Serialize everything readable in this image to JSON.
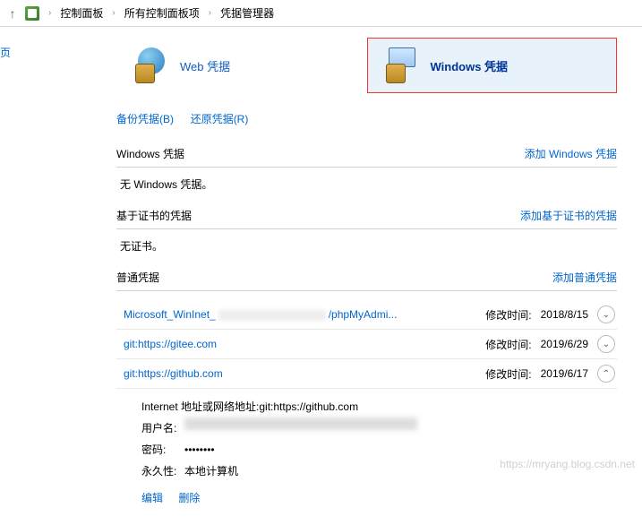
{
  "breadcrumb": {
    "root": "控制面板",
    "level1": "所有控制面板项",
    "level2": "凭据管理器"
  },
  "sidebar": {
    "home": "页"
  },
  "tabs": {
    "web": {
      "label": "Web 凭据"
    },
    "windows": {
      "label": "Windows 凭据"
    }
  },
  "links": {
    "backup": "备份凭据(B)",
    "restore": "还原凭据(R)"
  },
  "sections": {
    "windows": {
      "title": "Windows 凭据",
      "add": "添加 Windows 凭据",
      "empty": "无 Windows 凭据。"
    },
    "cert": {
      "title": "基于证书的凭据",
      "add": "添加基于证书的凭据",
      "empty": "无证书。"
    },
    "generic": {
      "title": "普通凭据",
      "add": "添加普通凭据"
    }
  },
  "creds": [
    {
      "name_pre": "Microsoft_WinInet_",
      "name_suf": "/phpMyAdmi...",
      "modified_label": "修改时间:",
      "modified": "2018/8/15"
    },
    {
      "name_pre": "git:https://gitee.com",
      "name_suf": "",
      "modified_label": "修改时间:",
      "modified": "2019/6/29"
    },
    {
      "name_pre": "git:https://github.com",
      "name_suf": "",
      "modified_label": "修改时间:",
      "modified": "2019/6/17"
    }
  ],
  "detail": {
    "addr_label": "Internet 地址或网络地址:",
    "addr_value": "git:https://github.com",
    "user_label": "用户名:",
    "pass_label": "密码:",
    "pass_value": "••••••••",
    "persist_label": "永久性:",
    "persist_value": "本地计算机",
    "edit": "编辑",
    "delete": "删除"
  },
  "watermark": "https://mryang.blog.csdn.net"
}
